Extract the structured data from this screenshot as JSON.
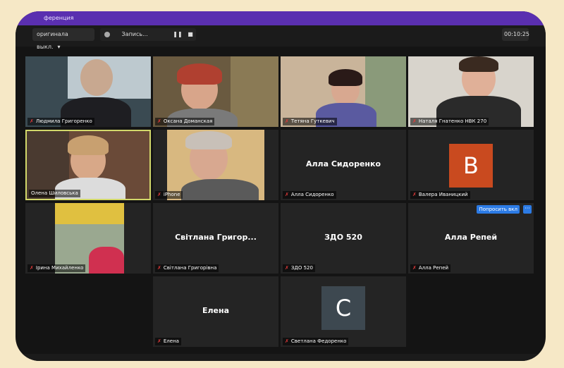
{
  "window": {
    "title": "ференция"
  },
  "topbar": {
    "view_button": "оригинала выкл.",
    "record_label": "Запись...",
    "pause_icon": "pause-icon",
    "stop_icon": "stop-icon",
    "timer": "00:10:25"
  },
  "participants": [
    {
      "name": "Людмила Григоренко",
      "video": true
    },
    {
      "name": "Оксана Доманская",
      "video": true
    },
    {
      "name": "Тетяна Гуткевич",
      "video": true
    },
    {
      "name": "Наталя Гнатенко НВК 270",
      "video": true
    },
    {
      "name": "Олена Шиловська",
      "video": true,
      "active_speaker": true
    },
    {
      "name": "iPhone",
      "video": true
    },
    {
      "name": "Алла Сидоренко",
      "display": "Алла Сидоренко",
      "video": false
    },
    {
      "name": "Валера Иваницкий",
      "avatar_letter": "B",
      "avatar_color": "#c94a1f",
      "video": false
    },
    {
      "name": "Ірина Михайленко",
      "video": true
    },
    {
      "name": "Світлана Григорівна",
      "display": "Світлана  Григор...",
      "video": false
    },
    {
      "name": "ЗДО 520",
      "display": "ЗДО 520",
      "video": false
    },
    {
      "name": "Алла Репей",
      "display": "Алла Репей",
      "video": false,
      "ask_button": "Попросить вкл",
      "more_button": "···"
    },
    {
      "name": "Елена",
      "display": "Елена",
      "video": false
    },
    {
      "name": "Светлана Федоренко",
      "avatar_letter": "C",
      "avatar_color": "#3d4850",
      "video": false
    }
  ],
  "colors": {
    "frame": "#141414",
    "titlebar": "#5a2fb0",
    "background": "#f6e8c6",
    "muted_mic": "#e03a3a",
    "active_border": "#d2d86a"
  }
}
